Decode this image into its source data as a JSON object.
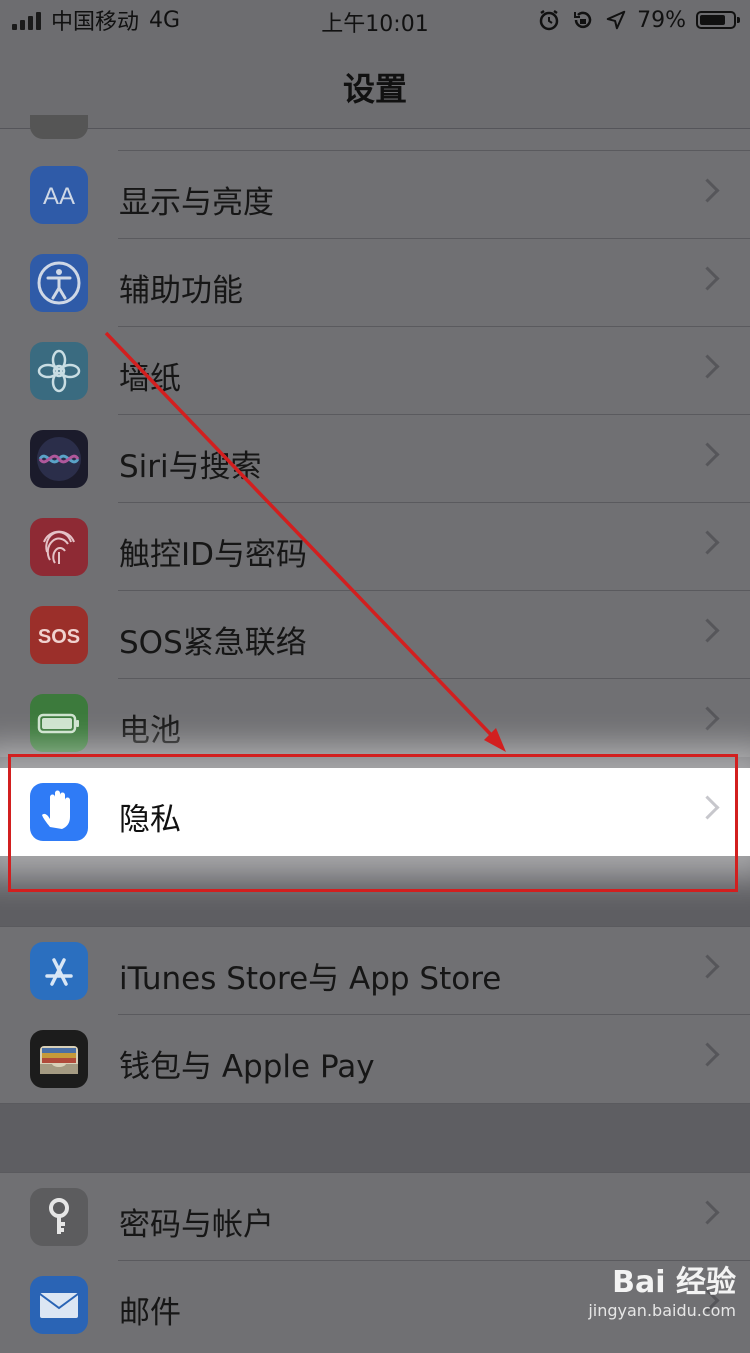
{
  "status_bar": {
    "carrier": "中国移动",
    "network": "4G",
    "time": "上午10:01",
    "battery_percent": "79%",
    "battery_level": 0.79
  },
  "nav": {
    "title": "设置"
  },
  "settings_group_1": [
    {
      "label": "显示与亮度",
      "icon": "display-brightness-icon",
      "icon_color": "#2f5ba8"
    },
    {
      "label": "辅助功能",
      "icon": "accessibility-icon",
      "icon_color": "#2f5ba8"
    },
    {
      "label": "墙纸",
      "icon": "wallpaper-flower-icon",
      "icon_color": "#3a6b80"
    },
    {
      "label": "Siri与搜索",
      "icon": "siri-icon",
      "icon_color": "#1b1b2b"
    },
    {
      "label": "触控ID与密码",
      "icon": "fingerprint-icon",
      "icon_color": "#8e2a34"
    },
    {
      "label": "SOS紧急联络",
      "icon": "sos-icon",
      "icon_color": "#9b2f2a"
    },
    {
      "label": "电池",
      "icon": "battery-icon",
      "icon_color": "#3c7a3c"
    }
  ],
  "highlighted_item": {
    "label": "隐私",
    "icon": "privacy-hand-icon",
    "icon_color": "#2f7bf6"
  },
  "settings_group_2": [
    {
      "label": "iTunes Store与 App Store",
      "icon": "app-store-icon",
      "icon_color": "#2b6fbf"
    },
    {
      "label": "钱包与 Apple Pay",
      "icon": "wallet-icon",
      "icon_color": "#1c1c1c"
    }
  ],
  "settings_group_3": [
    {
      "label": "密码与帐户",
      "icon": "key-icon",
      "icon_color": "#5c5c5e"
    },
    {
      "label": "邮件",
      "icon": "mail-icon",
      "icon_color": "#2a64b5"
    }
  ],
  "watermark": {
    "brand": "Bai 经验",
    "url": "jingyan.baidu.com"
  },
  "colors": {
    "annotation_red": "#d21f1f",
    "dim_background": "#5e5e62"
  }
}
